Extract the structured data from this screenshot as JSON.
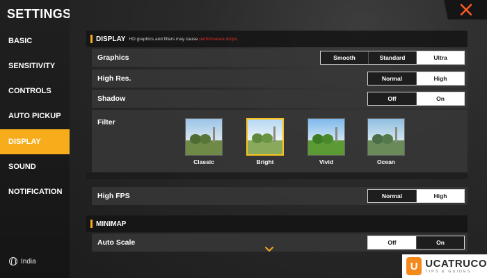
{
  "sidebar": {
    "title": "SETTINGS",
    "items": [
      {
        "label": "BASIC"
      },
      {
        "label": "SENSITIVITY"
      },
      {
        "label": "CONTROLS"
      },
      {
        "label": "AUTO PICKUP"
      },
      {
        "label": "DISPLAY",
        "active": true
      },
      {
        "label": "SOUND"
      },
      {
        "label": "NOTIFICATION"
      }
    ],
    "region": "India",
    "region_icon": "globe-icon"
  },
  "close_icon": "close-icon",
  "display": {
    "title": "DISPLAY",
    "note": "HD graphics and filters may cause",
    "warning": "performance drops.",
    "graphics": {
      "label": "Graphics",
      "options": [
        "Smooth",
        "Standard",
        "Ultra"
      ],
      "selected": "Ultra"
    },
    "high_res": {
      "label": "High Res.",
      "options": [
        "Normal",
        "High"
      ],
      "selected": "High"
    },
    "shadow": {
      "label": "Shadow",
      "options": [
        "Off",
        "On"
      ],
      "selected": "On"
    },
    "filter": {
      "label": "Filter",
      "options": [
        "Classic",
        "Bright",
        "Vivid",
        "Ocean"
      ],
      "selected": "Bright"
    },
    "high_fps": {
      "label": "High FPS",
      "options": [
        "Normal",
        "High"
      ],
      "selected": "High"
    }
  },
  "minimap": {
    "title": "MINIMAP",
    "auto_scale": {
      "label": "Auto Scale",
      "options": [
        "Off",
        "On"
      ],
      "selected": "Off"
    }
  },
  "scroll_icon": "chevron-down-icon",
  "watermark": {
    "brand": "UCATRUCO",
    "tagline": "TIPS & GUIDES",
    "accent": "#f48a1c"
  },
  "colors": {
    "accent": "#f7ad1b",
    "warning": "#e0302a",
    "selected_border": "#f7c321"
  }
}
